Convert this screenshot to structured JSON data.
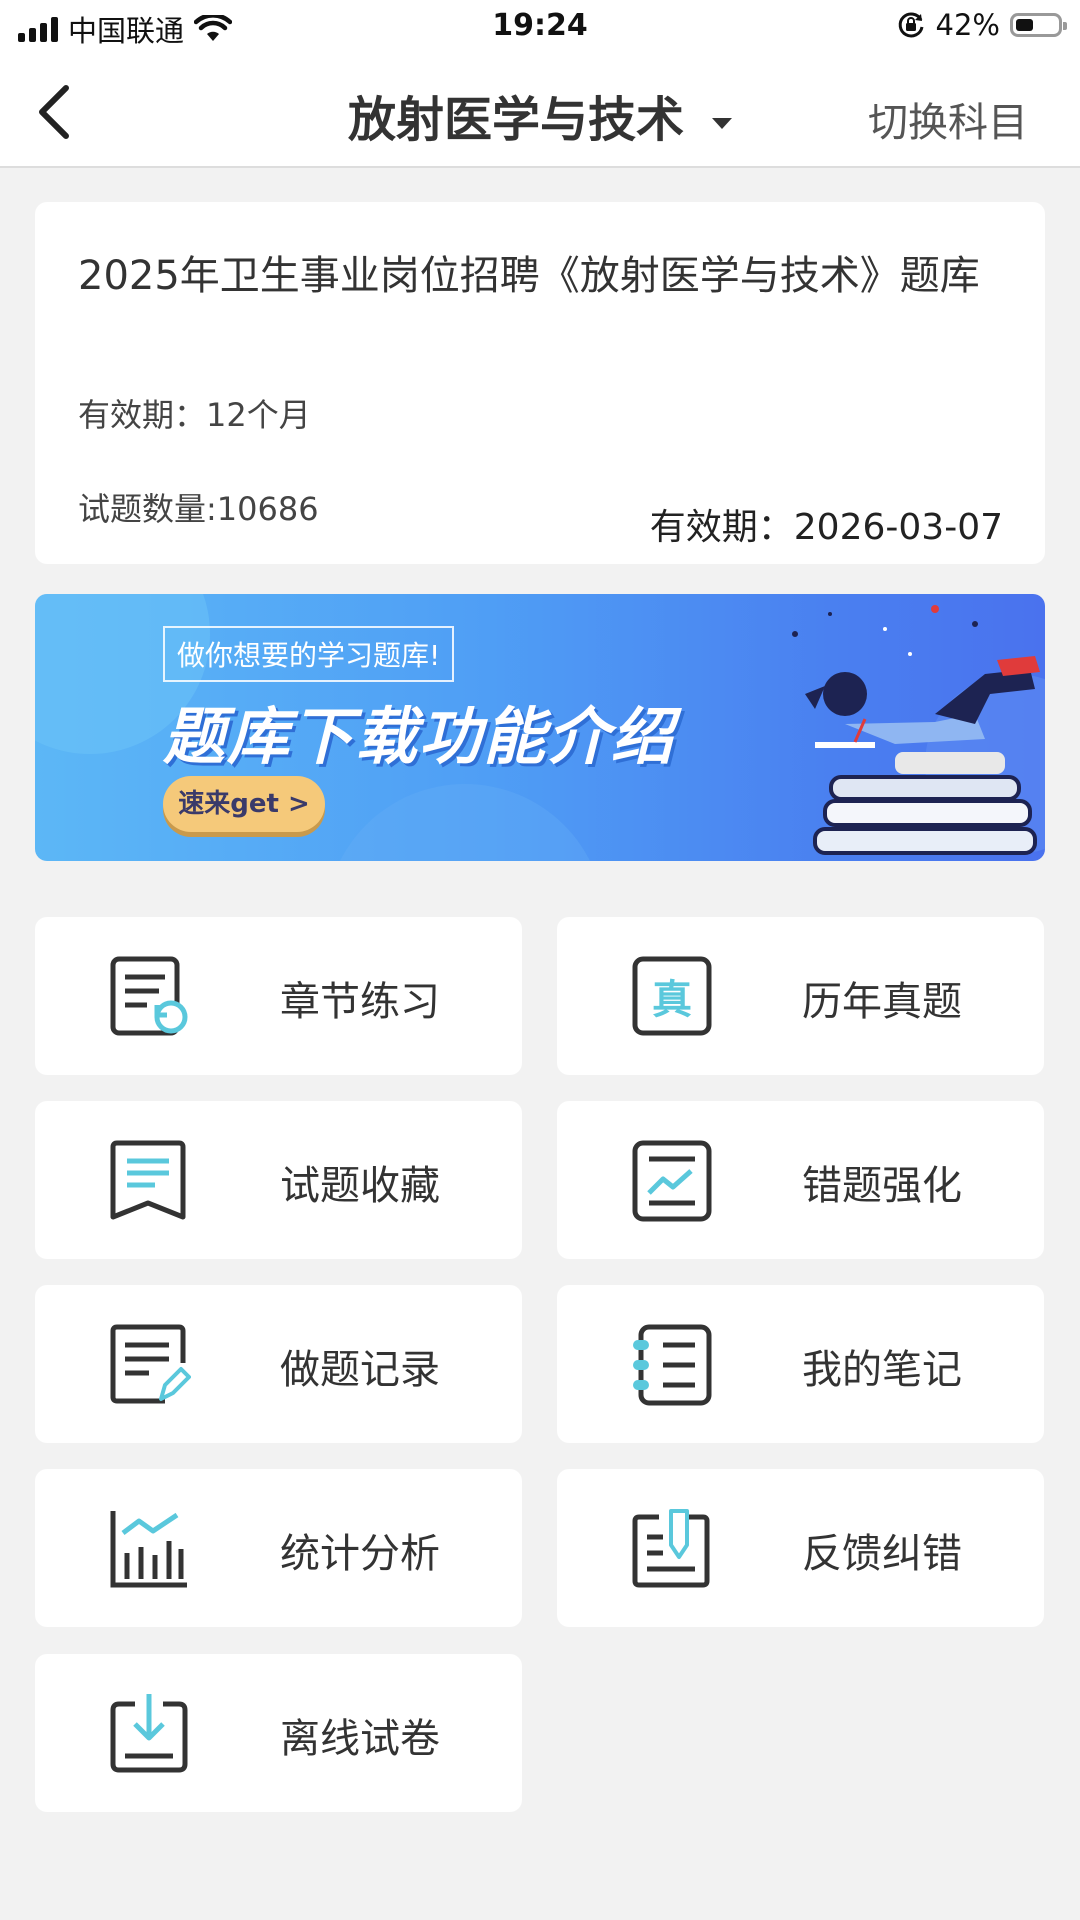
{
  "status_bar": {
    "carrier": "中国联通",
    "time": "19:24",
    "battery": "42%",
    "battery_level": 0.42
  },
  "nav": {
    "title": "放射医学与技术",
    "switch_label": "切换科目"
  },
  "bank": {
    "title": "2025年卫生事业岗位招聘《放射医学与技术》题库",
    "validity_label": "有效期：12个月",
    "count_label": "试题数量:10686",
    "expiry_label": "有效期：2026-03-07"
  },
  "banner": {
    "tag": "做你想要的学习题库!",
    "headline": "题库下载功能介绍",
    "button": "速来get >"
  },
  "menu": [
    {
      "label": "章节练习",
      "icon": "chapter-practice-icon"
    },
    {
      "label": "历年真题",
      "icon": "past-exams-icon"
    },
    {
      "label": "试题收藏",
      "icon": "favorites-icon"
    },
    {
      "label": "错题强化",
      "icon": "wrong-questions-icon"
    },
    {
      "label": "做题记录",
      "icon": "practice-record-icon"
    },
    {
      "label": "我的笔记",
      "icon": "notes-icon"
    },
    {
      "label": "统计分析",
      "icon": "statistics-icon"
    },
    {
      "label": "反馈纠错",
      "icon": "feedback-icon"
    },
    {
      "label": "离线试卷",
      "icon": "offline-paper-icon"
    }
  ],
  "colors": {
    "accent": "#5ac8dc",
    "icon_dark": "#333333",
    "banner_button": "#f5c97a"
  }
}
